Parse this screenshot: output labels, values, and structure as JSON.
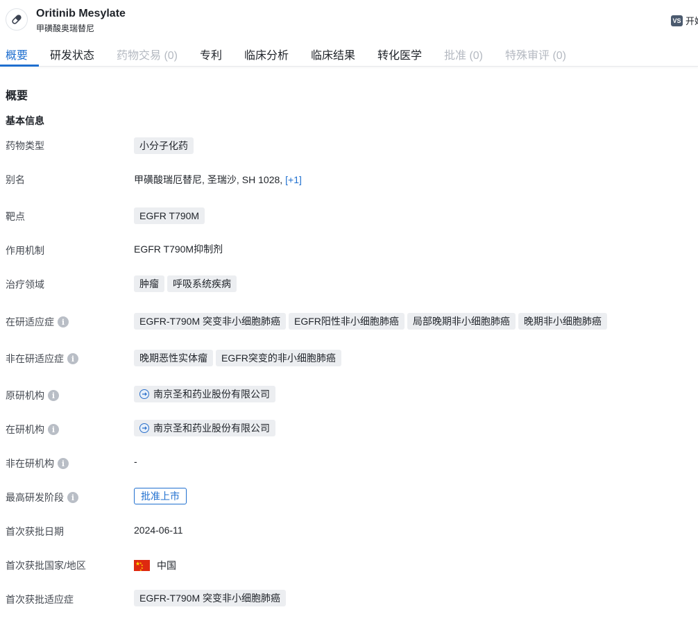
{
  "header": {
    "title": "Oritinib Mesylate",
    "subtitle": "甲磺酸奥瑞替尼",
    "right_badge": "VS",
    "right_text": "开始"
  },
  "tabs": [
    {
      "label": "概要",
      "state": "active"
    },
    {
      "label": "研发状态",
      "state": "normal"
    },
    {
      "label": "药物交易 (0)",
      "state": "disabled"
    },
    {
      "label": "专利",
      "state": "normal"
    },
    {
      "label": "临床分析",
      "state": "normal"
    },
    {
      "label": "临床结果",
      "state": "normal"
    },
    {
      "label": "转化医学",
      "state": "normal"
    },
    {
      "label": "批准 (0)",
      "state": "disabled"
    },
    {
      "label": "特殊审评 (0)",
      "state": "disabled"
    }
  ],
  "overview": {
    "section_title": "概要",
    "basic_info_title": "基本信息",
    "drug_type": {
      "label": "药物类型",
      "tags": [
        "小分子化药"
      ]
    },
    "alias": {
      "label": "别名",
      "values": [
        "甲磺酸瑞厄替尼,",
        "圣瑞沙,",
        "SH 1028,"
      ],
      "more": "[+1]"
    },
    "target": {
      "label": "靶点",
      "tags": [
        "EGFR T790M"
      ]
    },
    "mechanism": {
      "label": "作用机制",
      "value": "EGFR T790M抑制剂"
    },
    "therapeutic_area": {
      "label": "治疗领域",
      "tags": [
        "肿瘤",
        "呼吸系统疾病"
      ]
    },
    "active_indication": {
      "label": "在研适应症",
      "tags": [
        "EGFR-T790M 突变非小细胞肺癌",
        "EGFR阳性非小细胞肺癌",
        "局部晚期非小细胞肺癌",
        "晚期非小细胞肺癌"
      ]
    },
    "inactive_indication": {
      "label": "非在研适应症",
      "tags": [
        "晚期恶性实体瘤",
        "EGFR突变的非小细胞肺癌"
      ]
    },
    "originator": {
      "label": "原研机构",
      "org": "南京圣和药业股份有限公司"
    },
    "active_org": {
      "label": "在研机构",
      "org": "南京圣和药业股份有限公司"
    },
    "inactive_org": {
      "label": "非在研机构",
      "value": "-"
    },
    "highest_phase": {
      "label": "最高研发阶段",
      "value": "批准上市"
    },
    "first_approval_date": {
      "label": "首次获批日期",
      "value": "2024-06-11"
    },
    "first_approval_country": {
      "label": "首次获批国家/地区",
      "value": "中国"
    },
    "first_approval_indication": {
      "label": "首次获批适应症",
      "tags": [
        "EGFR-T790M 突变非小细胞肺癌"
      ]
    }
  }
}
